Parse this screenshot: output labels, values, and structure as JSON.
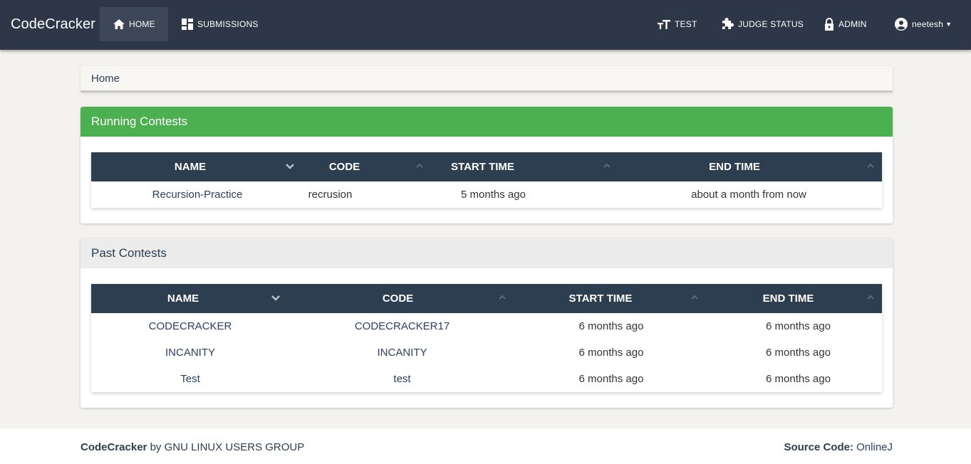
{
  "app": {
    "brand": "CodeCracker"
  },
  "nav": {
    "home": "HOME",
    "submissions": "SUBMISSIONS",
    "test": "TEST",
    "judge_status": "JUDGE STATUS",
    "admin": "ADMIN",
    "user": "neetesh"
  },
  "breadcrumb": {
    "current": "Home"
  },
  "running": {
    "title": "Running Contests",
    "columns": [
      "NAME",
      "CODE",
      "START TIME",
      "END TIME"
    ],
    "rows": [
      {
        "name": "Recursion-Practice",
        "code": "recrusion",
        "start": "5 months ago",
        "end": "about a month from now"
      }
    ]
  },
  "past": {
    "title": "Past Contests",
    "columns": [
      "NAME",
      "CODE",
      "START TIME",
      "END TIME"
    ],
    "rows": [
      {
        "name": "CODECRACKER",
        "code": "CODECRACKER17",
        "start": "6 months ago",
        "end": "6 months ago"
      },
      {
        "name": "INCANITY",
        "code": "INCANITY",
        "start": "6 months ago",
        "end": "6 months ago"
      },
      {
        "name": "Test",
        "code": "test",
        "start": "6 months ago",
        "end": "6 months ago"
      }
    ]
  },
  "footer": {
    "brand": "CodeCracker",
    "by_text": "by GNU LINUX USERS GROUP",
    "source_label": "Source Code:",
    "source_link": "OnlineJ"
  },
  "colors": {
    "navbar": "#2d3748",
    "running_header": "#4caf50",
    "table_header": "#2d3e50",
    "background": "#f3f2ef"
  }
}
